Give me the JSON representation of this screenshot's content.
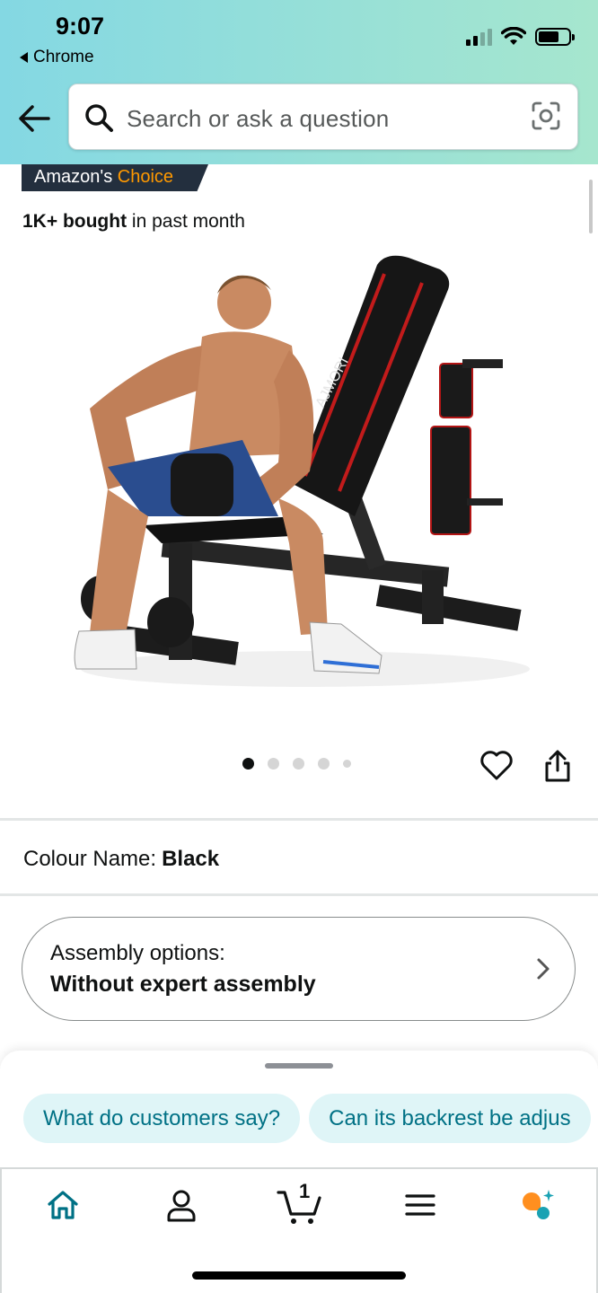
{
  "status_bar": {
    "time": "9:07",
    "back_app": "Chrome"
  },
  "search": {
    "placeholder": "Search or ask a question"
  },
  "product": {
    "badge_prefix": "Amazon's ",
    "badge_highlight": "Choice",
    "bought_bold": "1K+ bought",
    "bought_rest": " in past month",
    "image_dots": 5,
    "active_dot": 0
  },
  "variation": {
    "label": "Colour Name:",
    "value": "Black"
  },
  "assembly": {
    "label": "Assembly options:",
    "value": "Without expert assembly"
  },
  "suggestions": [
    "What do customers say?",
    "Can its backrest be adjus"
  ],
  "tabbar": {
    "cart_count": "1",
    "items": [
      "home-icon",
      "account-icon",
      "cart-icon",
      "menu-icon",
      "rufus-icon"
    ]
  },
  "colors": {
    "accent_teal": "#007185",
    "badge_bg": "#232f3e",
    "choice_orange": "#ff9900",
    "chip_bg": "#dff5f7"
  }
}
